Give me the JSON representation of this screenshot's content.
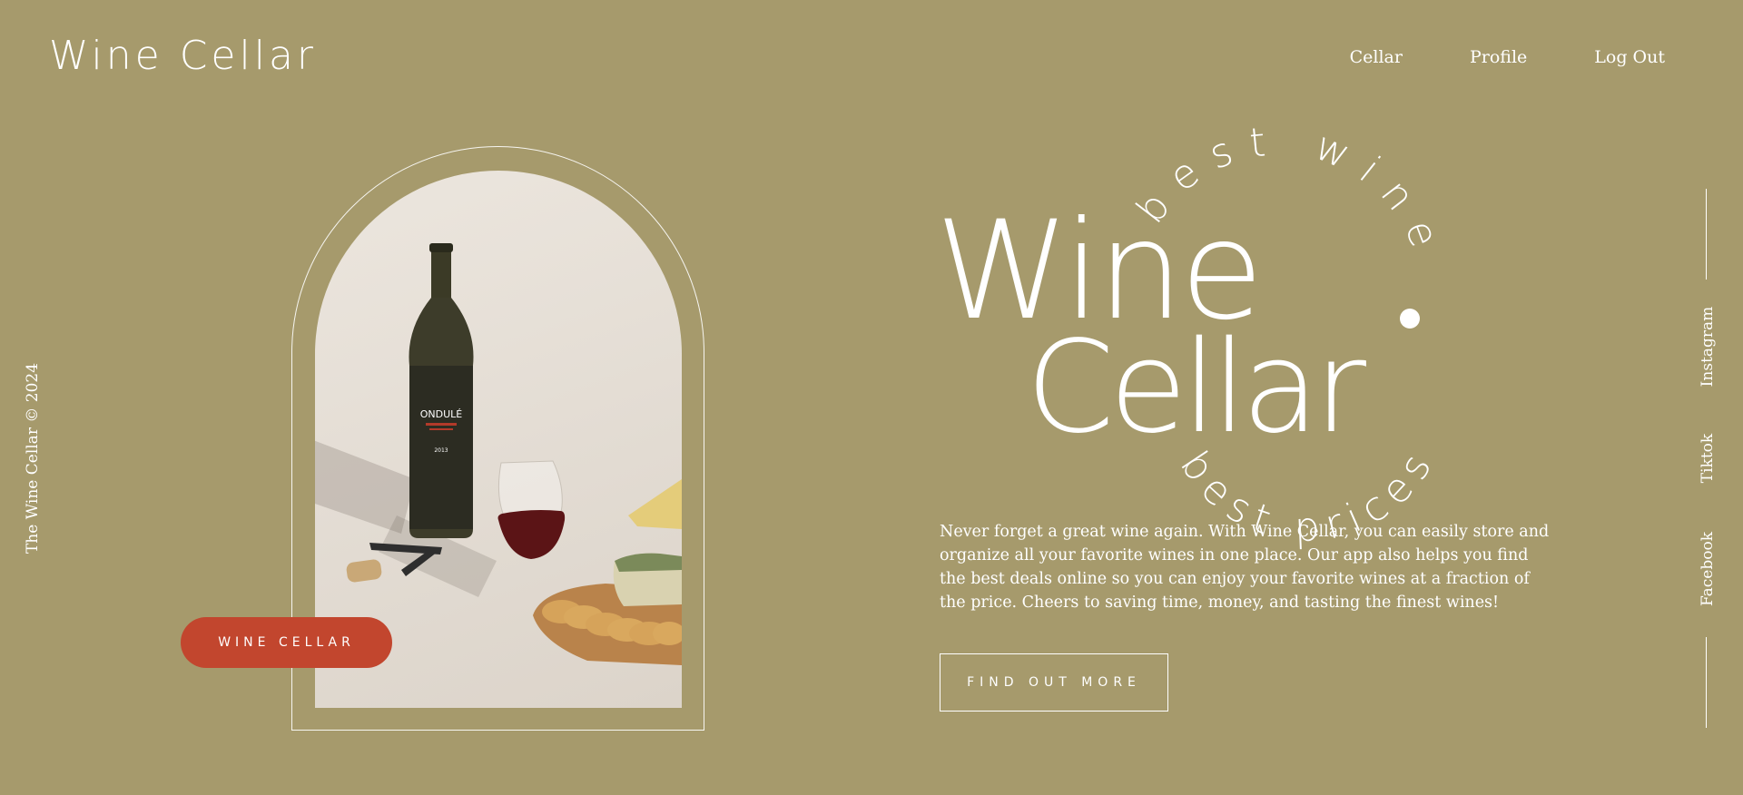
{
  "header": {
    "logo": "Wine Cellar",
    "nav": [
      "Cellar",
      "Profile",
      "Log Out"
    ]
  },
  "sidebar_left": {
    "copyright": "The Wine Cellar © 2024"
  },
  "hero": {
    "title_line1": "Wine",
    "title_line2": "Cellar",
    "arc_top": "best wine",
    "arc_bottom": "best prices",
    "description": "Never forget a great wine again. With Wine Cellar, you can easily store and organize all your favorite wines in one place. Our app also helps you find the best deals online so you can enjoy your favorite wines at a fraction of the price. Cheers to saving time, money, and tasting the finest wines!",
    "cta_label": "FIND OUT MORE",
    "badge_label": "WINE CELLAR",
    "bottle_label": "ONDULÉ",
    "bottle_year": "2013"
  },
  "social": [
    "Instagram",
    "Tiktok",
    "Facebook"
  ],
  "colors": {
    "background": "#a69a6c",
    "accent": "#c2462e",
    "text": "#ffffff"
  }
}
